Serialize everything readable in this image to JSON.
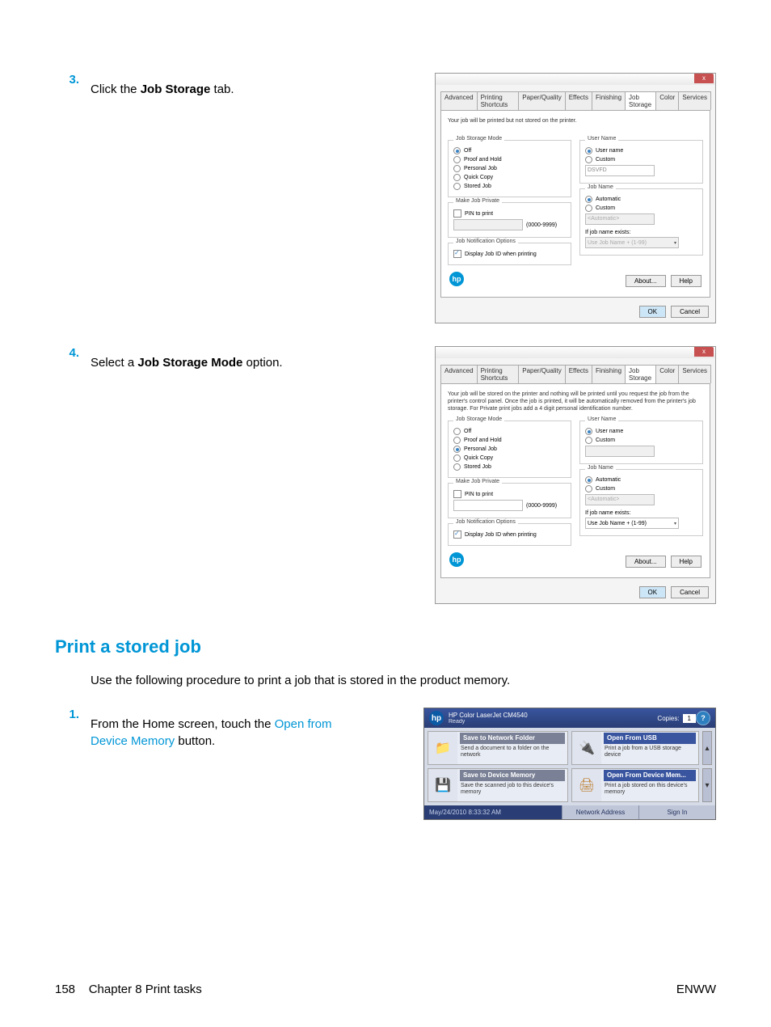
{
  "steps": {
    "s3": {
      "num": "3.",
      "pre": "Click the ",
      "bold": "Job Storage",
      "post": " tab."
    },
    "s4": {
      "num": "4.",
      "pre": "Select a ",
      "bold": "Job Storage Mode",
      "post": " option."
    }
  },
  "dialog": {
    "close": "x",
    "tabs": [
      "Advanced",
      "Printing Shortcuts",
      "Paper/Quality",
      "Effects",
      "Finishing",
      "Job Storage",
      "Color",
      "Services"
    ],
    "desc1": "Your job will be printed but not stored on the printer.",
    "desc2": "Your job will be stored on the printer and nothing will be printed until you request the job from the printer's control panel. Once the job is printed, it will be automatically removed from the printer's job storage. For Private print jobs add a 4 digit personal identification number.",
    "groups": {
      "mode": "Job Storage Mode",
      "opts": {
        "off": "Off",
        "proof": "Proof and Hold",
        "personal": "Personal Job",
        "quick": "Quick Copy",
        "stored": "Stored Job"
      },
      "priv": "Make Job Private",
      "pin": "PIN to print",
      "pinhint": "(0000-9999)",
      "notif": "Job Notification Options",
      "display": "Display Job ID when printing",
      "username": "User Name",
      "uname_auto": "User name",
      "custom": "Custom",
      "uname_val": "DSVFD",
      "jobname": "Job Name",
      "auto": "Automatic",
      "auto_val": "<Automatic>",
      "exists": "If job name exists:",
      "exists_val": "Use Job Name + (1-99)"
    },
    "buttons": {
      "about": "About...",
      "help": "Help",
      "ok": "OK",
      "cancel": "Cancel"
    }
  },
  "section": {
    "heading": "Print a stored job",
    "body": "Use the following procedure to print a job that is stored in the product memory."
  },
  "step1": {
    "num": "1.",
    "pre": "From the Home screen, touch the ",
    "link": "Open from Device Memory",
    "post": " button."
  },
  "panel": {
    "model": "HP Color LaserJet CM4540",
    "ready": "Ready",
    "copies_label": "Copies:",
    "copies_val": "1",
    "tiles": {
      "snf_head": "Save to Network Folder",
      "snf_body": "Send a document to a folder on the network",
      "ofu_head": "Open From USB",
      "ofu_body": "Print a job from a USB storage device",
      "sdm_head": "Save to Device Memory",
      "sdm_body": "Save the scanned job to this device's memory",
      "ofdm_head": "Open From Device Mem...",
      "ofdm_body": "Print a job stored on this device's memory"
    },
    "timestamp": "May/24/2010 8:33:32 AM",
    "net": "Network Address",
    "signin": "Sign In"
  },
  "footer": {
    "left_page": "158",
    "left_text": "Chapter 8   Print tasks",
    "right": "ENWW"
  }
}
